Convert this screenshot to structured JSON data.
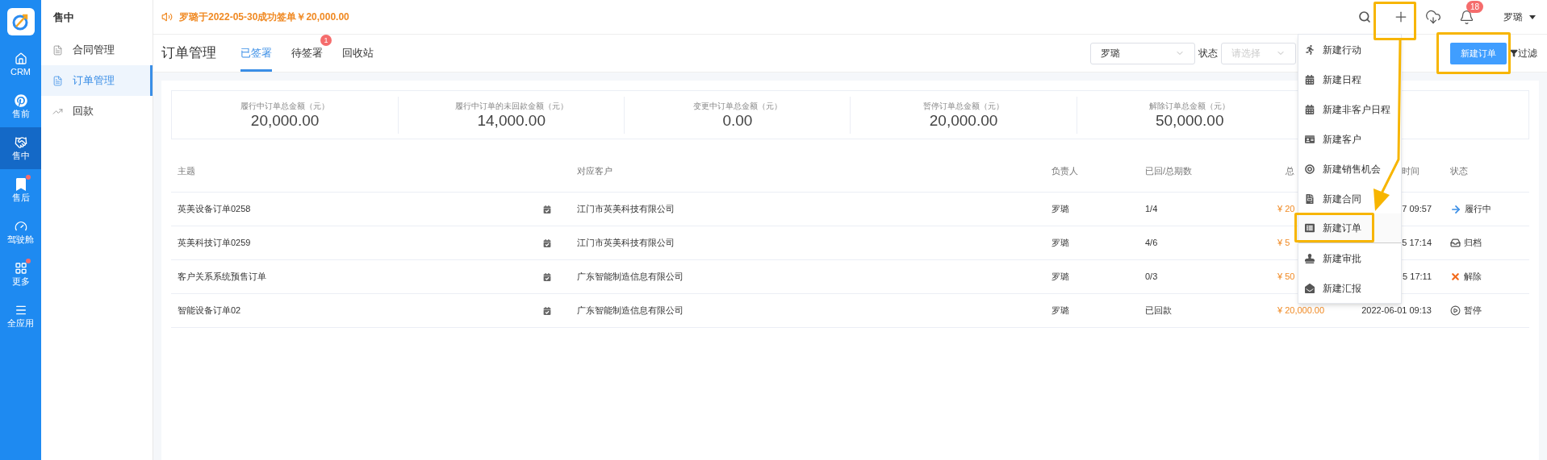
{
  "nav_rail": {
    "items": [
      {
        "label": "CRM",
        "selected": false,
        "dot": false
      },
      {
        "label": "售前",
        "selected": false,
        "dot": false
      },
      {
        "label": "售中",
        "selected": true,
        "dot": false
      },
      {
        "label": "售后",
        "selected": false,
        "dot": true
      },
      {
        "label": "驾驶舱",
        "selected": false,
        "dot": false
      },
      {
        "label": "更多",
        "selected": false,
        "dot": true
      },
      {
        "label": "全应用",
        "selected": false,
        "dot": false
      }
    ]
  },
  "sidebar": {
    "title": "售中",
    "items": [
      {
        "label": "合同管理",
        "selected": false
      },
      {
        "label": "订单管理",
        "selected": true
      },
      {
        "label": "回款",
        "selected": false
      }
    ]
  },
  "notice": "罗璐于2022-05-30成功签单￥20,000.00",
  "top_bar": {
    "notification_count": "18",
    "user": "罗璐"
  },
  "page_title": "订单管理",
  "tabs": [
    {
      "label": "已签署",
      "selected": true
    },
    {
      "label": "待签署",
      "selected": false,
      "badge": "1"
    },
    {
      "label": "回收站",
      "selected": false
    }
  ],
  "filters": {
    "owner": "罗璐",
    "status_label": "状态",
    "status_placeholder": "请选择"
  },
  "new_order_button": "新建订单",
  "filter_button": "过滤",
  "stats": [
    {
      "label": "履行中订单总金额（元）",
      "value": "20,000.00"
    },
    {
      "label": "履行中订单的未回款金额（元）",
      "value": "14,000.00"
    },
    {
      "label": "变更中订单总金额（元）",
      "value": "0.00"
    },
    {
      "label": "暂停订单总金额（元）",
      "value": "20,000.00"
    },
    {
      "label": "解除订单总金额（元）",
      "value": "50,000.00"
    }
  ],
  "table": {
    "columns": [
      "主题",
      "对应客户",
      "负责人",
      "已回/总期数",
      "总",
      "时间",
      "状态"
    ],
    "rows": [
      {
        "subject": "英美设备订单0258",
        "customer": "江门市英美科技有限公司",
        "owner": "罗璐",
        "periods": "1/4",
        "amount": "¥ 20",
        "time": "7 09:57",
        "status": {
          "label": "履行中",
          "kind": "active"
        }
      },
      {
        "subject": "英美科技订单0259",
        "customer": "江门市英美科技有限公司",
        "owner": "罗璐",
        "periods": "4/6",
        "amount": "¥ 5",
        "time": "5 17:14",
        "status": {
          "label": "归档",
          "kind": "archived"
        }
      },
      {
        "subject": "客户关系系统预售订单",
        "customer": "广东智能制造信息有限公司",
        "owner": "罗璐",
        "periods": "0/3",
        "amount": "¥ 50",
        "time": "5 17:11",
        "status": {
          "label": "解除",
          "kind": "cancelled"
        }
      },
      {
        "subject": "智能设备订单02",
        "customer": "广东智能制造信息有限公司",
        "owner": "罗璐",
        "periods": "已回款",
        "amount": "¥ 20,000.00",
        "time": "2022-06-01 09:13",
        "status": {
          "label": "暂停",
          "kind": "paused"
        }
      }
    ]
  },
  "create_menu": {
    "items": [
      {
        "label": "新建行动",
        "selected": false
      },
      {
        "label": "新建日程",
        "selected": false
      },
      {
        "label": "新建非客户日程",
        "selected": false
      },
      {
        "label": "新建客户",
        "selected": false
      },
      {
        "label": "新建销售机会",
        "selected": false
      },
      {
        "label": "新建合同",
        "selected": false
      },
      {
        "label": "新建订单",
        "selected": true
      },
      {
        "label": "新建审批",
        "selected": false
      },
      {
        "label": "新建汇报",
        "selected": false
      }
    ]
  }
}
